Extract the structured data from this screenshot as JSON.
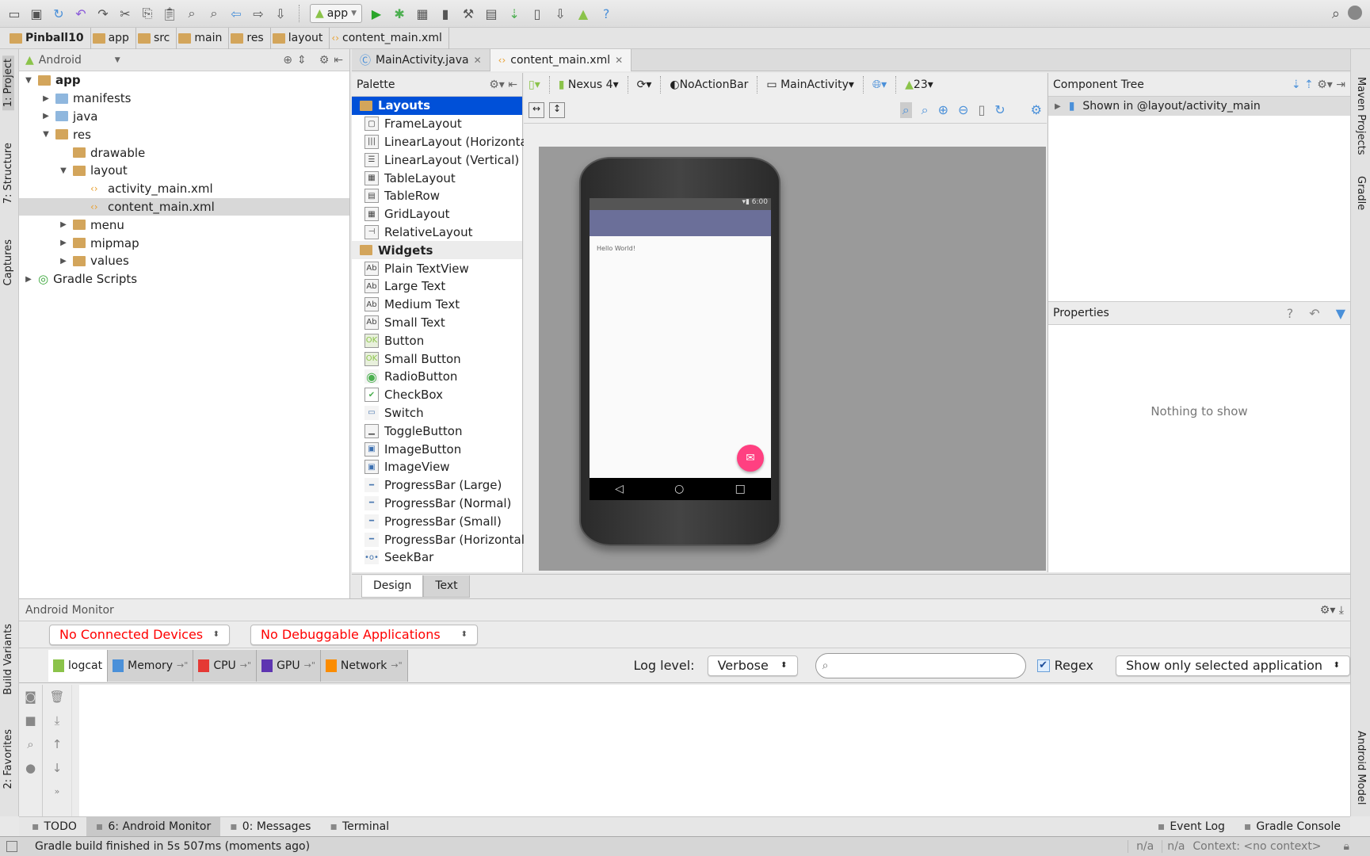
{
  "colors": {
    "accent": "#0050d8",
    "error_text": "#ff0000",
    "fab": "#ff4081",
    "action_bar": "#6b6f99",
    "android_green": "#8bc34a"
  },
  "toolbar": {
    "run_config": "app",
    "icons": [
      "open-folder-icon",
      "save-icon",
      "sync-icon",
      "undo-icon",
      "redo-icon",
      "cut-icon",
      "copy-icon",
      "paste-icon",
      "find-icon",
      "replace-icon",
      "back-icon",
      "forward-icon",
      "make-project-icon"
    ],
    "run_icons": [
      "run-icon",
      "debug-icon",
      "coverage-icon",
      "attach-debugger-icon",
      "project-structure-icon",
      "sdk-manager-icon",
      "sync-gradle-icon",
      "avd-manager-icon",
      "android-device-monitor-icon",
      "android-icon",
      "help-icon"
    ]
  },
  "breadcrumb": [
    "Pinball10",
    "app",
    "src",
    "main",
    "res",
    "layout",
    "content_main.xml"
  ],
  "left_strip": {
    "project": "1: Project",
    "structure": "7: Structure",
    "captures": "Captures",
    "build_variants": "Build Variants",
    "favorites": "2: Favorites"
  },
  "right_strip": {
    "maven": "Maven Projects",
    "gradle": "Gradle",
    "android_model": "Android Model"
  },
  "project": {
    "view": "Android",
    "tree": [
      {
        "label": "app",
        "depth": 0,
        "arrow": "down",
        "icon": "module",
        "bold": true
      },
      {
        "label": "manifests",
        "depth": 1,
        "arrow": "right",
        "icon": "folder-blue"
      },
      {
        "label": "java",
        "depth": 1,
        "arrow": "right",
        "icon": "folder-blue"
      },
      {
        "label": "res",
        "depth": 1,
        "arrow": "down",
        "icon": "folder-res"
      },
      {
        "label": "drawable",
        "depth": 2,
        "arrow": "",
        "icon": "folder"
      },
      {
        "label": "layout",
        "depth": 2,
        "arrow": "down",
        "icon": "folder"
      },
      {
        "label": "activity_main.xml",
        "depth": 3,
        "arrow": "",
        "icon": "xml"
      },
      {
        "label": "content_main.xml",
        "depth": 3,
        "arrow": "",
        "icon": "xml",
        "selected": true
      },
      {
        "label": "menu",
        "depth": 2,
        "arrow": "right",
        "icon": "folder"
      },
      {
        "label": "mipmap",
        "depth": 2,
        "arrow": "right",
        "icon": "folder"
      },
      {
        "label": "values",
        "depth": 2,
        "arrow": "right",
        "icon": "folder"
      },
      {
        "label": "Gradle Scripts",
        "depth": 0,
        "arrow": "right",
        "icon": "gradle"
      }
    ]
  },
  "editor_tabs": [
    {
      "label": "MainActivity.java",
      "active": false
    },
    {
      "label": "content_main.xml",
      "active": true
    }
  ],
  "palette": {
    "title": "Palette",
    "items": [
      {
        "label": "Layouts",
        "group": true,
        "selected": true
      },
      {
        "label": "FrameLayout",
        "icon": "▢"
      },
      {
        "label": "LinearLayout (Horizontal)",
        "icon": "|||"
      },
      {
        "label": "LinearLayout (Vertical)",
        "icon": "☰"
      },
      {
        "label": "TableLayout",
        "icon": "▦"
      },
      {
        "label": "TableRow",
        "icon": "▤"
      },
      {
        "label": "GridLayout",
        "icon": "▦"
      },
      {
        "label": "RelativeLayout",
        "icon": "⊣"
      },
      {
        "label": "Widgets",
        "group": true
      },
      {
        "label": "Plain TextView",
        "icon": "Ab"
      },
      {
        "label": "Large Text",
        "icon": "Ab"
      },
      {
        "label": "Medium Text",
        "icon": "Ab"
      },
      {
        "label": "Small Text",
        "icon": "Ab"
      },
      {
        "label": "Button",
        "icon": "OK"
      },
      {
        "label": "Small Button",
        "icon": "OK"
      },
      {
        "label": "RadioButton",
        "icon": "◉"
      },
      {
        "label": "CheckBox",
        "icon": "✔"
      },
      {
        "label": "Switch",
        "icon": "▭"
      },
      {
        "label": "ToggleButton",
        "icon": "▁"
      },
      {
        "label": "ImageButton",
        "icon": "▣"
      },
      {
        "label": "ImageView",
        "icon": "▣"
      },
      {
        "label": "ProgressBar (Large)",
        "icon": "━"
      },
      {
        "label": "ProgressBar (Normal)",
        "icon": "━"
      },
      {
        "label": "ProgressBar (Small)",
        "icon": "━"
      },
      {
        "label": "ProgressBar (Horizontal)",
        "icon": "━"
      },
      {
        "label": "SeekBar",
        "icon": "•o•"
      }
    ]
  },
  "designer": {
    "device": "Nexus 4",
    "theme": "NoActionBar",
    "activity": "MainActivity",
    "api": "23",
    "phone_time": "6:00",
    "hello": "Hello World!",
    "tabs": [
      "Design",
      "Text"
    ],
    "active_tab": "Design"
  },
  "component_tree": {
    "title": "Component Tree",
    "item": "Shown in @layout/activity_main"
  },
  "properties": {
    "title": "Properties",
    "empty": "Nothing to show"
  },
  "monitor": {
    "title": "Android Monitor",
    "devices": "No Connected Devices",
    "apps": "No Debuggable Applications",
    "tabs": [
      {
        "label": "logcat",
        "color": "#8bc34a"
      },
      {
        "label": "Memory",
        "color": "#4a90d9"
      },
      {
        "label": "CPU",
        "color": "#e53935"
      },
      {
        "label": "GPU",
        "color": "#5e35b1"
      },
      {
        "label": "Network",
        "color": "#fb8c00"
      }
    ],
    "log_level_label": "Log level:",
    "log_level": "Verbose",
    "search_value": "",
    "regex_label": "Regex",
    "regex_checked": true,
    "filter": "Show only selected application"
  },
  "bottom_tools": {
    "left": [
      {
        "label": "TODO"
      },
      {
        "label": "6: Android Monitor",
        "active": true
      },
      {
        "label": "0: Messages"
      },
      {
        "label": "Terminal"
      }
    ],
    "right": [
      {
        "label": "Event Log"
      },
      {
        "label": "Gradle Console"
      }
    ]
  },
  "status": {
    "message": "Gradle build finished in 5s 507ms (moments ago)",
    "pos1": "n/a",
    "pos2": "n/a",
    "context": "Context: <no context>"
  }
}
